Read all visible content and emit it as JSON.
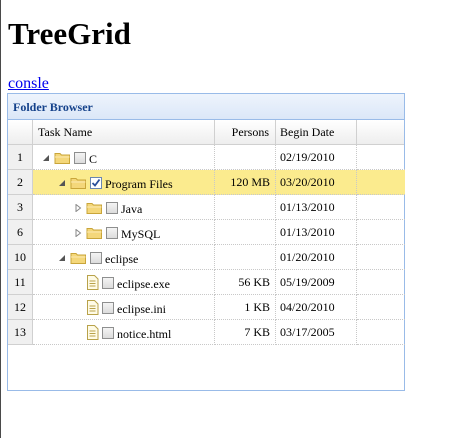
{
  "page": {
    "title": "TreeGrid",
    "link_label": "consle"
  },
  "panel": {
    "title": "Folder Browser"
  },
  "grid": {
    "columns": {
      "task": "Task Name",
      "persons": "Persons",
      "date": "Begin Date"
    },
    "rows": [
      {
        "num": "1",
        "name": "C",
        "persons": "",
        "date": "02/19/2010",
        "level": 0,
        "type": "folder",
        "expander": "expanded",
        "checked": false,
        "selected": false
      },
      {
        "num": "2",
        "name": "Program Files",
        "persons": "120 MB",
        "date": "03/20/2010",
        "level": 1,
        "type": "folder",
        "expander": "expanded",
        "checked": true,
        "selected": true
      },
      {
        "num": "3",
        "name": "Java",
        "persons": "",
        "date": "01/13/2010",
        "level": 2,
        "type": "folder",
        "expander": "collapsed",
        "checked": false,
        "selected": false
      },
      {
        "num": "6",
        "name": "MySQL",
        "persons": "",
        "date": "01/13/2010",
        "level": 2,
        "type": "folder",
        "expander": "collapsed",
        "checked": false,
        "selected": false
      },
      {
        "num": "10",
        "name": "eclipse",
        "persons": "",
        "date": "01/20/2010",
        "level": 1,
        "type": "folder",
        "expander": "expanded",
        "checked": false,
        "selected": false
      },
      {
        "num": "11",
        "name": "eclipse.exe",
        "persons": "56 KB",
        "date": "05/19/2009",
        "level": 2,
        "type": "file",
        "expander": "none",
        "checked": false,
        "selected": false
      },
      {
        "num": "12",
        "name": "eclipse.ini",
        "persons": "1 KB",
        "date": "04/20/2010",
        "level": 2,
        "type": "file",
        "expander": "none",
        "checked": false,
        "selected": false
      },
      {
        "num": "13",
        "name": "notice.html",
        "persons": "7 KB",
        "date": "03/17/2005",
        "level": 2,
        "type": "file",
        "expander": "none",
        "checked": false,
        "selected": false
      }
    ]
  },
  "icons": {
    "expanded": "triangle-down-icon",
    "collapsed": "triangle-right-icon",
    "folder": "folder-icon",
    "file": "file-icon",
    "checkbox": "checkbox-icon"
  },
  "colors": {
    "selected_row": "#fbeb8e",
    "panel_header_text": "#15428b",
    "panel_border": "#99bbe8",
    "link": "#0000ee"
  }
}
